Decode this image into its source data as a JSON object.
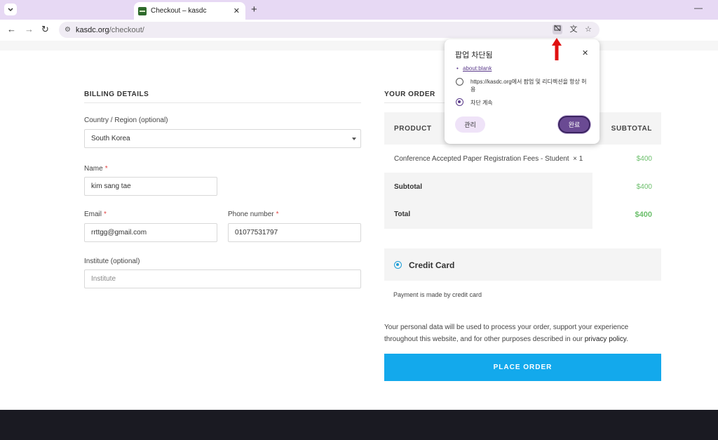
{
  "browser": {
    "tab_title": "Checkout – kasdc",
    "tab_close": "✕",
    "new_tab": "+",
    "minimize": "—",
    "url_host": "kasdc.org",
    "url_path": "/checkout/"
  },
  "billing": {
    "heading": "BILLING DETAILS",
    "country_label": "Country / Region (optional)",
    "country_value": "South Korea",
    "name_label": "Name",
    "name_value": "kim sang tae",
    "email_label": "Email",
    "email_value": "rrttgg@gmail.com",
    "phone_label": "Phone number",
    "phone_value": "01077531797",
    "institute_label": "Institute (optional)",
    "institute_placeholder": "Institute",
    "required_mark": "*"
  },
  "order": {
    "heading": "YOUR ORDER",
    "col_product": "PRODUCT",
    "col_subtotal": "SUBTOTAL",
    "item_name": "Conference Accepted Paper Registration Fees - Student",
    "item_qty": "× 1",
    "item_price": "$400",
    "subtotal_label": "Subtotal",
    "subtotal_value": "$400",
    "total_label": "Total",
    "total_value": "$400"
  },
  "payment": {
    "method": "Credit Card",
    "description": "Payment is made by credit card",
    "privacy_text": "Your personal data will be used to process your order, support your experience throughout this website, and for other purposes described in our",
    "privacy_link": "privacy policy",
    "place_order": "PLACE ORDER"
  },
  "popup": {
    "title": "팝업 차단됨",
    "close": "✕",
    "blocked_link": "about:blank",
    "option_allow": "https://kasdc.org에서 팝업 및 리디렉션을 항상 허용",
    "option_block": "차단 계속",
    "manage_button": "관리",
    "done_button": "완료",
    "selected_option": "block"
  },
  "colors": {
    "accent_blue": "#13a9ec",
    "price_green": "#6bbf6b",
    "popup_purple": "#6a4a93",
    "tab_strip": "#e7d9f4",
    "annotation_red": "#e01010"
  }
}
